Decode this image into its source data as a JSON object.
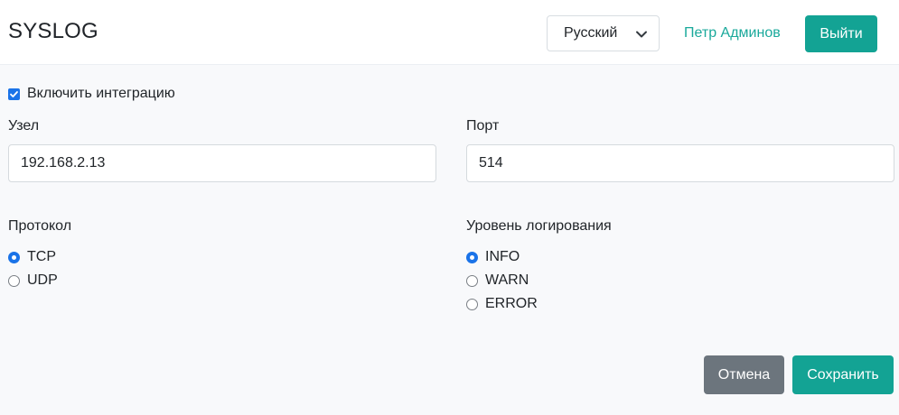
{
  "header": {
    "title": "SYSLOG",
    "language": "Русский",
    "user_name": "Петр Админов",
    "logout_label": "Выйти"
  },
  "form": {
    "enable_integration": {
      "label": "Включить интеграцию",
      "checked": true
    },
    "host": {
      "label": "Узел",
      "value": "192.168.2.13"
    },
    "port": {
      "label": "Порт",
      "value": "514"
    },
    "protocol": {
      "label": "Протокол",
      "options": [
        "TCP",
        "UDP"
      ],
      "selected": "TCP"
    },
    "log_level": {
      "label": "Уровень логирования",
      "options": [
        "INFO",
        "WARN",
        "ERROR"
      ],
      "selected": "INFO"
    }
  },
  "actions": {
    "cancel_label": "Отмена",
    "save_label": "Сохранить"
  },
  "colors": {
    "accent": "#13a394",
    "link": "#1aa99b",
    "cancel": "#6c757d",
    "control_checked": "#1a73e8",
    "body_bg": "#f8f9fb"
  },
  "icons": {
    "language_dropdown": "chevron-down-icon",
    "checkbox": "checkmark-icon"
  }
}
